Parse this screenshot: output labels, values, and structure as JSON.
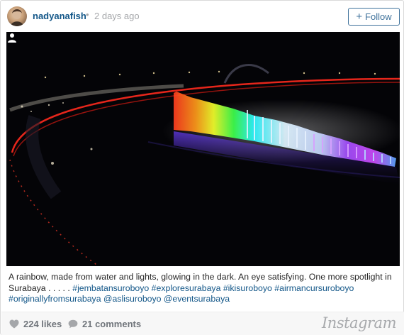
{
  "post": {
    "username": "nadyanafish",
    "separator": "•",
    "time_ago": "2 days ago",
    "follow_label": "Follow",
    "follow_icon": "plus-icon"
  },
  "caption": {
    "text": "A rainbow, made from water and lights, glowing in the dark. An eye satisfying. One more spotlight in Surabaya",
    "dots": ". . . . .",
    "hashtags": "#jembatansuroboyo #exploresurabaya #ikisuroboyo #airmancursuroboyo #originallyfromsurabaya",
    "mentions": "@aslisuroboyo @eventsurabaya"
  },
  "stats": {
    "likes": "224 likes",
    "comments": "21 comments"
  },
  "brand": "Instagram",
  "colors": {
    "link": "#125688",
    "follow": "#3f729b",
    "muted": "#a5a7aa"
  }
}
